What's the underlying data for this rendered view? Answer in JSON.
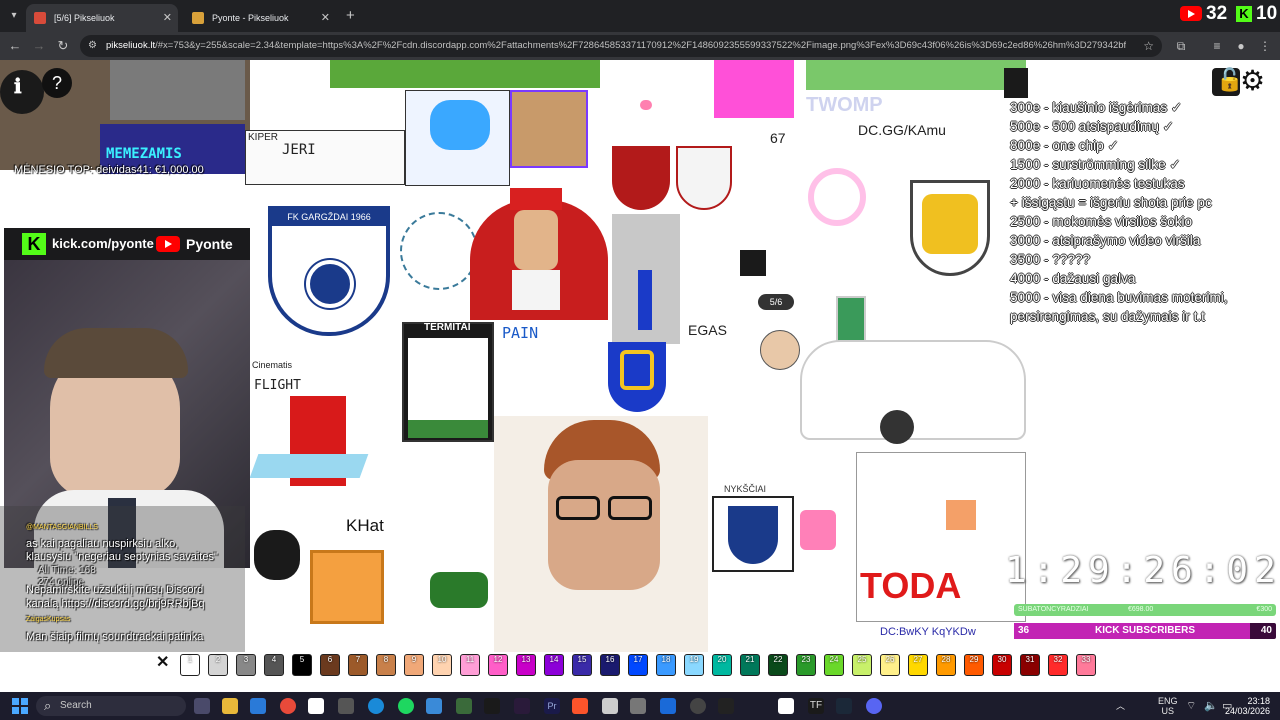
{
  "browser": {
    "tabs": [
      {
        "label": "[5/6] Pikseliuok",
        "active": true,
        "favicon_color": "#d84b3a"
      },
      {
        "label": "Pyonte - Pikseliuok",
        "active": false,
        "favicon_color": "#d8a13a"
      }
    ],
    "url_host": "pikseliuok.lt",
    "url_rest": "/#x=753&y=255&scale=2.34&template=https%3A%2F%2Fcdn.discordapp.com%2Fattachments%2F728645853371170912%2F1486092355599337522%2Fimage.png%3Fex%3D69c43f06%26is%3D69c2ed86%26hm%3D279342bfa23cc773..."
  },
  "stream_counters": {
    "youtube_count": "32",
    "kick_count": "10"
  },
  "webcam": {
    "kick_url": "kick.com/pyonte",
    "youtube_name": "Pyonte"
  },
  "overlay": {
    "monthly_top": "MĖNESIO TOP: deividas41: €1,000.00",
    "chat": [
      "@MANTASGIANBILLS",
      "as kai pagaliau nuspirksiu alko,",
      "klausysiu \"negeriau septynias savaites\"",
      "All Time: 168",
      "274 online",
      "Nepamirškite užsukti į mūsų Discord",
      "kanalą https://discord.gg/brj9RRbjBq",
      "ZaigasKupsas",
      "Man šiaip filmų soundtrackai patinka"
    ]
  },
  "canvas_labels": {
    "pixel_counter": "5/6",
    "score_67": "67",
    "twoomp": "TWOMP",
    "dc_gg": "DC.GG/KAmu",
    "termitai": "TERMITAI",
    "pain": "PAIN",
    "egas": "EGAS",
    "flight": "FLIGHT",
    "kinematis": "Cinematis",
    "nyksciai": "NYKŠČIAI",
    "toda": "TODA",
    "dc_bwky": "DC:BwKY KqYKDw",
    "fk_gargzdai": "FK GARGŽDAI 1966",
    "kiper": "KIPER",
    "jeri": "JERI",
    "khat": "KHat",
    "meme": "MEMEZAMIS"
  },
  "goals": [
    "300e - kiaušinio išgėrimas ✓",
    "500e - 500 atsispaudimų ✓",
    "800e - one chip ✓",
    "1500 - surströmming silke ✓",
    "2000 - kariuomenės testukas",
    "+ išsigąstu = išgeriu shota prie pc",
    "2500 - mokomės virsilos šokio",
    "3000 - atsiprašymo video viršila",
    "3500 - ?????",
    "4000 - dažausi galva",
    "5000 - visa diena buvimas moterimi,",
    "persirengimas, su dažymais ir t.t"
  ],
  "timer": {
    "value": "1:29:26:02"
  },
  "subs": {
    "top_bar_left": "SUBATONCYRADZIAI",
    "top_bar_center": "€698.00",
    "top_bar_right": "€300",
    "current": "36",
    "label": "KICK SUBSCRIBERS",
    "goal": "40",
    "progress": 0.9
  },
  "palette": {
    "numbers": [
      "1",
      "2",
      "3",
      "4",
      "5",
      "6",
      "7",
      "8",
      "9",
      "10",
      "11",
      "12",
      "13",
      "14",
      "15",
      "16",
      "17",
      "18",
      "19",
      "20",
      "21",
      "22",
      "23",
      "24",
      "25",
      "26",
      "27",
      "28",
      "29",
      "30",
      "31",
      "32",
      "33"
    ],
    "colors": [
      "#ffffff",
      "#d4d4d4",
      "#888888",
      "#555555",
      "#000000",
      "#6b3a1e",
      "#9c5a2a",
      "#c8804a",
      "#f0a878",
      "#ffd3b0",
      "#ff9ed6",
      "#ff5ec8",
      "#c800c8",
      "#8c00d8",
      "#3a2aa8",
      "#1a1a6e",
      "#0048ff",
      "#3a9aff",
      "#8ad8ff",
      "#00b8a0",
      "#00785a",
      "#0a4a1a",
      "#2a9a2a",
      "#6ad82a",
      "#c8f06a",
      "#fff08a",
      "#ffd800",
      "#ff9a00",
      "#ff5a00",
      "#c80000",
      "#8a0000",
      "#ff2a2a",
      "#ff7a9a"
    ]
  },
  "taskbar": {
    "search_placeholder": "Search",
    "lang": "ENG",
    "region": "US",
    "time": "23:18",
    "date": "24/03/2026"
  }
}
